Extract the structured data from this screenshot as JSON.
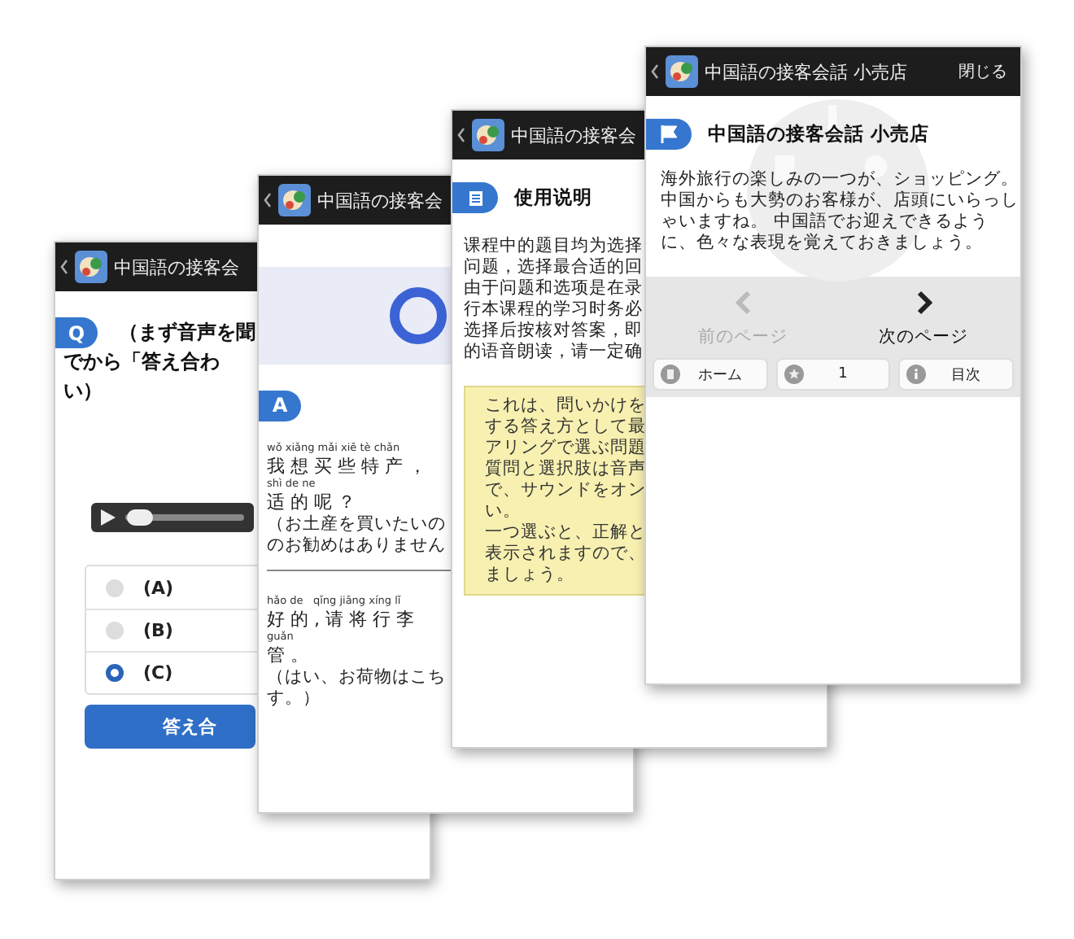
{
  "screens": [
    {
      "kind": "quiz",
      "header": {
        "title": "中国語の接客会"
      },
      "question": {
        "badge": "Q",
        "lines": [
          "（まず音声を聞",
          "でから「答え合わ",
          "い）"
        ]
      },
      "player": {
        "level": 0.02
      },
      "options": [
        {
          "label": "(A)",
          "selected": false
        },
        {
          "label": "(B)",
          "selected": false
        },
        {
          "label": "(C)",
          "selected": true
        }
      ],
      "button": "答え合"
    },
    {
      "kind": "answer",
      "header": {
        "title": "中国語の接客会"
      },
      "badge": "A",
      "dialogs": [
        {
          "lines": [
            {
              "pinyin": "wǒ xiǎng mǎi xiē tè chǎn",
              "hanzi": "我 想 买 些 特 产 ，"
            },
            {
              "pinyin": "shì de ne",
              "hanzi": "适 的 呢 ？"
            }
          ],
          "translation": [
            "（お土産を買いたいの",
            "のお勧めはありません"
          ]
        },
        {
          "lines": [
            {
              "pinyin": "hǎo de   qǐng jiāng xíng lǐ",
              "hanzi": "好 的 , 请 将 行 李"
            },
            {
              "pinyin": "guǎn",
              "hanzi": "管 。"
            }
          ],
          "translation": [
            "（はい、お荷物はこち",
            "す。）"
          ]
        }
      ]
    },
    {
      "kind": "help",
      "header": {
        "title": "中国語の接客会"
      },
      "heading": "使用说明",
      "paragraph": [
        "课程中的题目均为选择",
        "问题，选择最合适的回",
        "由于问题和选项是在录",
        "行本课程的学习时务必",
        "选择后按核对答案，即",
        "的语音朗读，请一定确"
      ],
      "note": [
        "これは、問いかけを",
        "する答え方として最",
        "アリングで選ぶ問題",
        "質問と選択肢は音声",
        "で、サウンドをオン",
        "い。",
        "一つ選ぶと、正解と",
        "表示されますので、",
        "ましょう。"
      ]
    },
    {
      "kind": "intro",
      "header": {
        "title": "中国語の接客会話 小売店",
        "close": "閉じる"
      },
      "heading": "中国語の接客会話 小売店",
      "paragraph": [
        "海外旅行の楽しみの一つが、ショッピング。",
        "中国からも大勢のお客様が、店頭にいらっし",
        "ゃいますね。 中国語でお迎えできるよう",
        "に、色々な表現を覚えておきましょう。"
      ],
      "nav": [
        {
          "label": "前のページ",
          "disabled": true
        },
        {
          "label": "次のページ",
          "disabled": false
        }
      ],
      "toolbar": [
        {
          "kind": "home",
          "label": "ホーム"
        },
        {
          "kind": "star",
          "label": "1"
        },
        {
          "kind": "info",
          "label": "目次"
        }
      ]
    }
  ]
}
